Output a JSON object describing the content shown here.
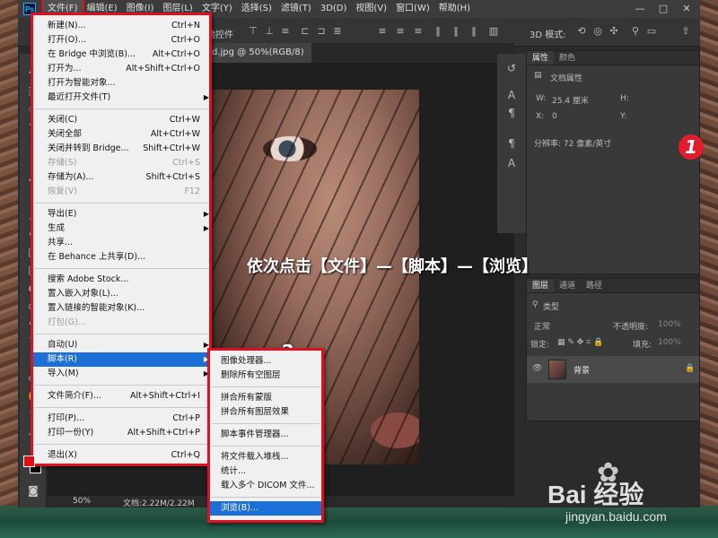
{
  "menubar": {
    "logo": "Ps",
    "items": [
      "文件(F)",
      "编辑(E)",
      "图像(I)",
      "图层(L)",
      "文字(Y)",
      "选择(S)",
      "滤镜(T)",
      "3D(D)",
      "视图(V)",
      "窗口(W)",
      "帮助(H)"
    ],
    "controls": [
      "—",
      "□",
      "✕"
    ]
  },
  "options": {
    "label": "动控件",
    "mode_label": "3D 模式:"
  },
  "document_tab": {
    "title": "d.jpg @ 50%(RGB/8)"
  },
  "status": {
    "zoom": "50%",
    "doc": "文档:2.22M/2.22M"
  },
  "file_menu": [
    {
      "label": "新建(N)...",
      "shortcut": "Ctrl+N"
    },
    {
      "label": "打开(O)...",
      "shortcut": "Ctrl+O"
    },
    {
      "label": "在 Bridge 中浏览(B)...",
      "shortcut": "Alt+Ctrl+O"
    },
    {
      "label": "打开为...",
      "shortcut": "Alt+Shift+Ctrl+O"
    },
    {
      "label": "打开为智能对象..."
    },
    {
      "label": "最近打开文件(T)",
      "submenu": true
    },
    {
      "label": "关闭(C)",
      "shortcut": "Ctrl+W"
    },
    {
      "label": "关闭全部",
      "shortcut": "Alt+Ctrl+W"
    },
    {
      "label": "关闭并转到 Bridge...",
      "shortcut": "Shift+Ctrl+W"
    },
    {
      "label": "存储(S)",
      "shortcut": "Ctrl+S",
      "disabled": true
    },
    {
      "label": "存储为(A)...",
      "shortcut": "Shift+Ctrl+S"
    },
    {
      "label": "恢复(V)",
      "shortcut": "F12",
      "disabled": true
    },
    {
      "label": "导出(E)",
      "submenu": true
    },
    {
      "label": "生成",
      "submenu": true
    },
    {
      "label": "共享..."
    },
    {
      "label": "在 Behance 上共享(D)..."
    },
    {
      "label": "搜索 Adobe Stock..."
    },
    {
      "label": "置入嵌入对象(L)..."
    },
    {
      "label": "置入链接的智能对象(K)..."
    },
    {
      "label": "打包(G)...",
      "disabled": true
    },
    {
      "label": "自动(U)",
      "submenu": true
    },
    {
      "label": "脚本(R)",
      "submenu": true,
      "highlight": true
    },
    {
      "label": "导入(M)",
      "submenu": true
    },
    {
      "label": "文件简介(F)...",
      "shortcut": "Alt+Shift+Ctrl+I"
    },
    {
      "label": "打印(P)...",
      "shortcut": "Ctrl+P"
    },
    {
      "label": "打印一份(Y)",
      "shortcut": "Alt+Shift+Ctrl+P"
    },
    {
      "label": "退出(X)",
      "shortcut": "Ctrl+Q"
    }
  ],
  "script_menu": [
    {
      "label": "图像处理器..."
    },
    {
      "label": "删除所有空图层"
    },
    {
      "label": "拼合所有蒙版"
    },
    {
      "label": "拼合所有图层效果"
    },
    {
      "label": "脚本事件管理器..."
    },
    {
      "label": "将文件载入堆栈..."
    },
    {
      "label": "统计..."
    },
    {
      "label": "载入多个 DICOM 文件..."
    },
    {
      "label": "浏览(B)...",
      "highlight": true
    }
  ],
  "properties_panel": {
    "tabs": [
      "属性",
      "颜色"
    ],
    "title": "文档属性",
    "w_label": "W:",
    "w_value": "25.4 厘米",
    "h_label": "H:",
    "x_label": "X:",
    "x_value": "0",
    "y_label": "Y:",
    "resolution": "分辨率: 72 像素/英寸"
  },
  "layers_panel": {
    "tabs": [
      "图层",
      "通道",
      "路径"
    ],
    "filter": "类型",
    "blend_mode": "正常",
    "opacity_label": "不透明度:",
    "opacity_value": "100%",
    "lock_label": "锁定:",
    "fill_label": "填充:",
    "fill_value": "100%",
    "layer_name": "背景"
  },
  "annotation": {
    "instruction": "依次点击【文件】—【脚本】—【浏览】",
    "step1": "1",
    "step2": "2"
  },
  "watermark": {
    "logo": "Bai 经验",
    "url": "jingyan.baidu.com"
  },
  "colors": {
    "highlight": "#1b6fd6",
    "annotation_red": "#e01020",
    "foreground": "#e01010",
    "background": "#000000"
  }
}
